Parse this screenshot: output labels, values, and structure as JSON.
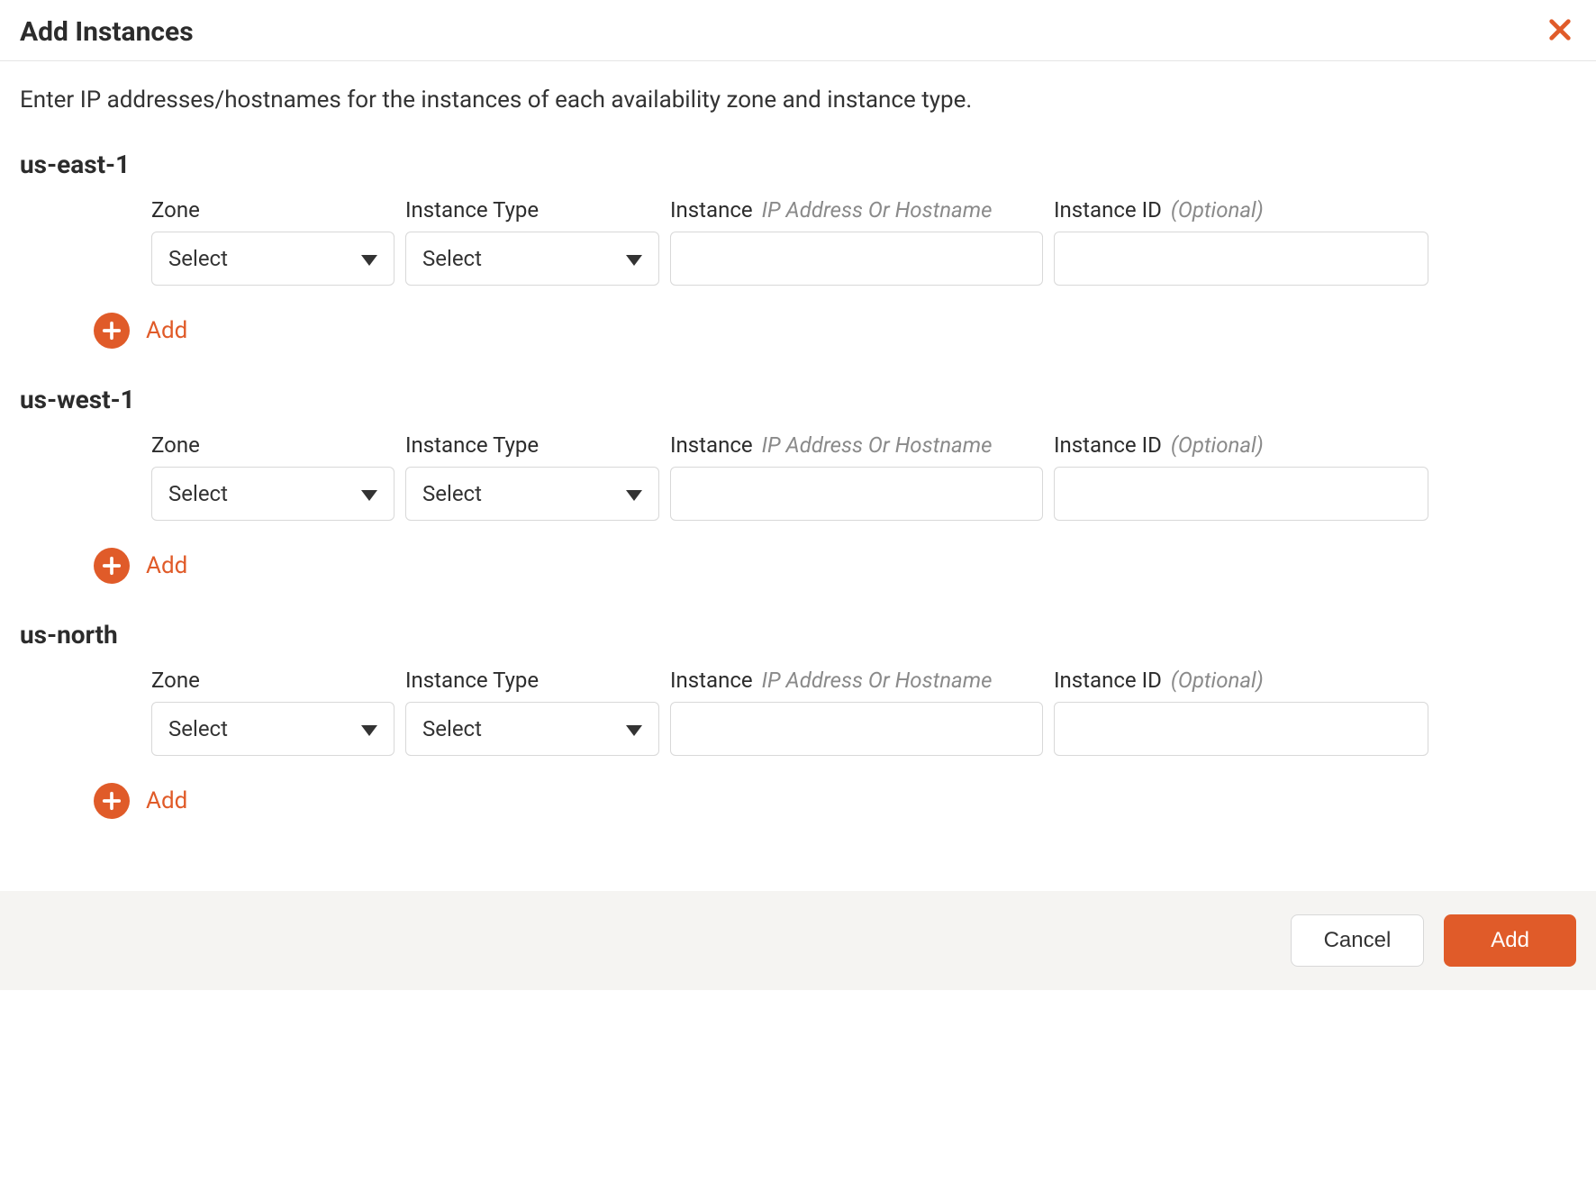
{
  "modal": {
    "title": "Add Instances",
    "instructions": "Enter IP addresses/hostnames for the instances of each availability zone and instance type."
  },
  "labels": {
    "zone": "Zone",
    "instance_type": "Instance Type",
    "instance": "Instance",
    "instance_hint": "IP Address Or Hostname",
    "instance_id": "Instance ID",
    "instance_id_hint": "(Optional)",
    "select_placeholder": "Select",
    "add_row": "Add"
  },
  "regions": [
    {
      "name": "us-east-1"
    },
    {
      "name": "us-west-1"
    },
    {
      "name": "us-north"
    }
  ],
  "footer": {
    "cancel": "Cancel",
    "add": "Add"
  },
  "colors": {
    "accent": "#e05b29"
  }
}
